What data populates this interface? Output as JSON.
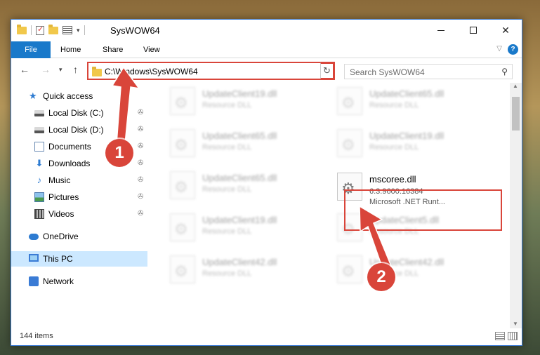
{
  "window": {
    "title": "SysWOW64",
    "qat_dropdown_glyph": "▾"
  },
  "ribbon": {
    "tabs": [
      "File",
      "Home",
      "Share",
      "View"
    ]
  },
  "address_bar": {
    "path": "C:\\Windows\\SysWOW64"
  },
  "search": {
    "placeholder": "Search SysWOW64"
  },
  "sidebar": {
    "quick_access": "Quick access",
    "items": [
      {
        "label": "Local Disk (C:)",
        "icon": "disk-icon",
        "pinned": true
      },
      {
        "label": "Local Disk (D:)",
        "icon": "disk-icon",
        "pinned": true
      },
      {
        "label": "Documents",
        "icon": "documents-icon",
        "pinned": true
      },
      {
        "label": "Downloads",
        "icon": "downloads-icon",
        "pinned": true
      },
      {
        "label": "Music",
        "icon": "music-icon",
        "pinned": true
      },
      {
        "label": "Pictures",
        "icon": "pictures-icon",
        "pinned": true
      },
      {
        "label": "Videos",
        "icon": "videos-icon",
        "pinned": true
      }
    ],
    "onedrive": "OneDrive",
    "this_pc": "This PC",
    "network": "Network",
    "selected": "This PC"
  },
  "files": {
    "left_column": [
      {
        "name": "UpdateClient19.dll",
        "desc": "Resource DLL"
      },
      {
        "name": "UpdateClient65.dll",
        "desc": "Resource DLL"
      },
      {
        "name": "UpdateClient65.dll",
        "desc": "Resource DLL"
      },
      {
        "name": "UpdateClient19.dll",
        "desc": "Resource DLL"
      },
      {
        "name": "UpdateClient42.dll",
        "desc": "Resource DLL"
      }
    ],
    "right_column": [
      {
        "name": "UpdateClient65.dll",
        "desc": "Resource DLL"
      },
      {
        "name": "UpdateClient19.dll",
        "desc": "Resource DLL"
      },
      {
        "name": "UpdateClient5.dll",
        "desc": "Resource DLL"
      },
      {
        "name": "UpdateClient42.dll",
        "desc": "Resource DLL"
      }
    ],
    "highlighted": {
      "name": "mscoree.dll",
      "version": "6.3.9600.16384",
      "desc": "Microsoft .NET Runt..."
    }
  },
  "status": {
    "item_count": "144 items"
  },
  "annotations": {
    "callout_1": "1",
    "callout_2": "2",
    "highlight_color": "#d9453a"
  },
  "icons": {
    "back": "←",
    "forward": "→",
    "recent": "▾",
    "up": "↑",
    "refresh": "↻",
    "search": "⚲",
    "pin": "📌",
    "close": "✕",
    "ribbon_collapse": "▽",
    "help": "?",
    "addr_dropdown": "▾",
    "scroll_up": "▲",
    "scroll_down": "▼"
  }
}
